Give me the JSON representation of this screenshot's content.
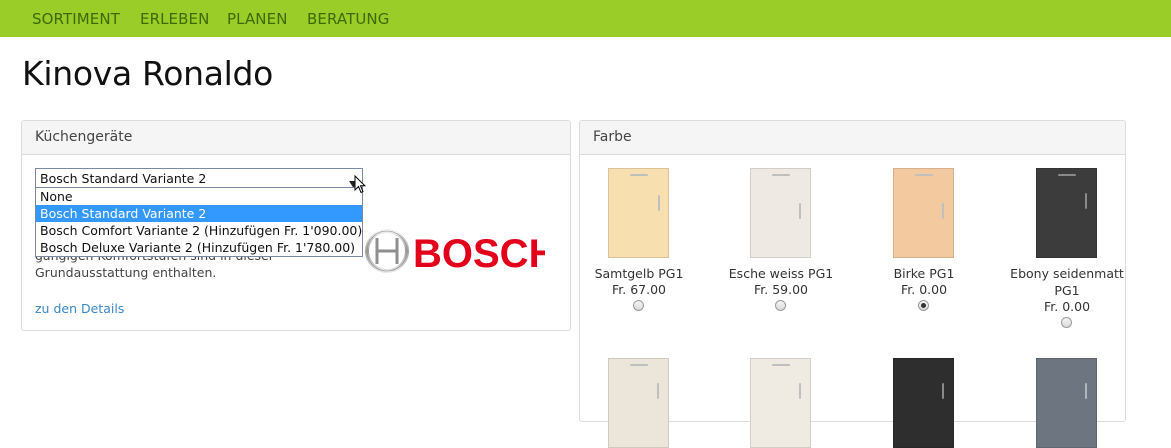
{
  "nav": {
    "items": [
      "SORTIMENT",
      "ERLEBEN",
      "PLANEN",
      "BERATUNG"
    ]
  },
  "page": {
    "title": "Kinova Ronaldo"
  },
  "appliances": {
    "heading": "Küchengeräte",
    "select_value": "Bosch Standard Variante 2",
    "options": [
      "None",
      "Bosch Standard Variante 2",
      "Bosch Comfort Variante 2 (Hinzufügen Fr. 1'090.00)",
      "Bosch Deluxe Variante 2 (Hinzufügen Fr. 1'780.00)"
    ],
    "selected_option_index": 1,
    "description_line1": "gängigen Komfortstufen sind in dieser",
    "description_line2": "Grundausstattung enthalten.",
    "details_link": "zu den Details",
    "logo_text": "BOSCH",
    "logo_color": "#e2001a"
  },
  "colors_panel": {
    "heading": "Farbe",
    "swatches": [
      {
        "name": "Samtgelb PG1",
        "price": "Fr. 67.00",
        "color": "#f7dfb0",
        "checked": false
      },
      {
        "name": "Esche weiss PG1",
        "price": "Fr. 59.00",
        "color": "#eeeae3",
        "checked": false
      },
      {
        "name": "Birke PG1",
        "price": "Fr. 0.00",
        "color": "#f3c9a0",
        "checked": true
      },
      {
        "name": "Ebony seidenmatt PG1",
        "price": "Fr. 0.00",
        "color": "#3c3c3c",
        "checked": false
      }
    ],
    "second_row_colors": [
      "#ece6da",
      "#efebe3",
      "#2e2e2e",
      "#6d7580"
    ]
  },
  "theme": {
    "nav_bg": "#9acd28",
    "nav_text": "#3d6a06",
    "link": "#3a87c8",
    "selection": "#3399ff"
  }
}
